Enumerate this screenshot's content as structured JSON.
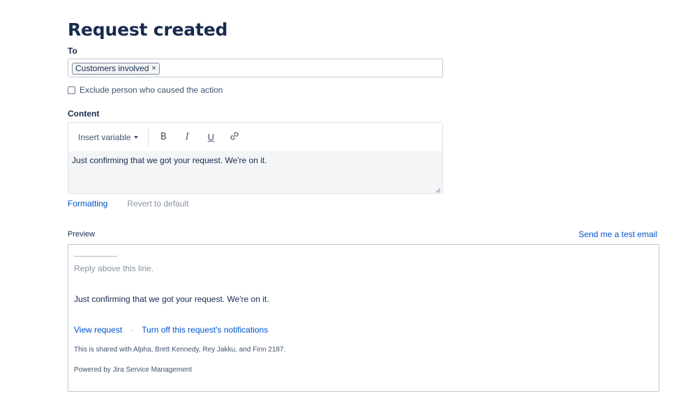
{
  "header": {
    "title": "Request created"
  },
  "to": {
    "label": "To",
    "chips": [
      "Customers involved"
    ],
    "remove_glyph": "×"
  },
  "exclude": {
    "label": "Exclude person who caused the action",
    "checked": false
  },
  "content": {
    "label": "Content",
    "insert_variable": "Insert variable",
    "toolbar": {
      "bold": "B",
      "italic": "I",
      "underline": "U"
    },
    "body": "Just confirming that we got your request. We're on it."
  },
  "actions": {
    "formatting": "Formatting",
    "revert": "Revert to default"
  },
  "preview": {
    "label": "Preview",
    "send_test": "Send me a test email",
    "reply_line": "Reply above this line.",
    "message": "Just confirming that we got your request. We're on it.",
    "view_request": "View request",
    "separator": "·",
    "turn_off": "Turn off this request's notifications",
    "shared": "This is shared with Alpha, Brett Kennedy, Rey Jakku, and Finn 2187.",
    "powered": "Powered by Jira Service Management"
  },
  "colors": {
    "link": "#0052cc",
    "text": "#172b4d",
    "muted": "#8993a4"
  }
}
